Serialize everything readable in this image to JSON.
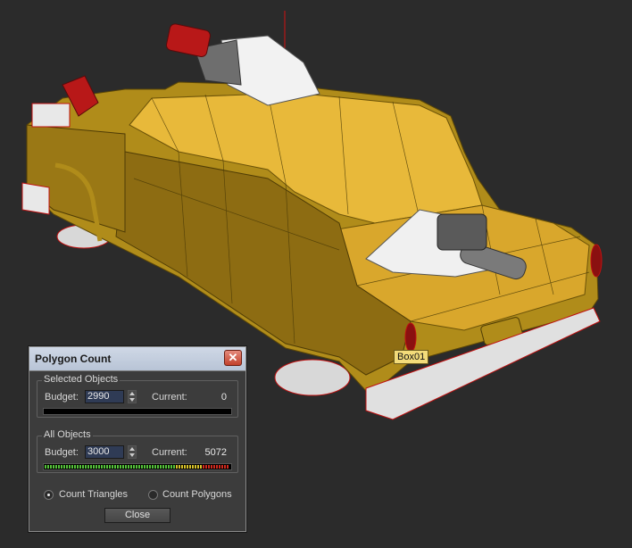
{
  "viewport": {
    "object_label": "Box01"
  },
  "dialog": {
    "title": "Polygon Count",
    "selected": {
      "group_label": "Selected Objects",
      "budget_label": "Budget:",
      "budget_value": "2990",
      "current_label": "Current:",
      "current_value": "0",
      "meter_fraction": 0.0
    },
    "all": {
      "group_label": "All Objects",
      "budget_label": "Budget:",
      "budget_value": "3000",
      "current_label": "Current:",
      "current_value": "5072",
      "meter_fraction": 1.0
    },
    "radio_triangles": "Count Triangles",
    "radio_polygons": "Count Polygons",
    "close_label": "Close"
  },
  "colors": {
    "meter_green": "#55c33a",
    "meter_yellow": "#d8c22a",
    "meter_red": "#d02a1e"
  }
}
